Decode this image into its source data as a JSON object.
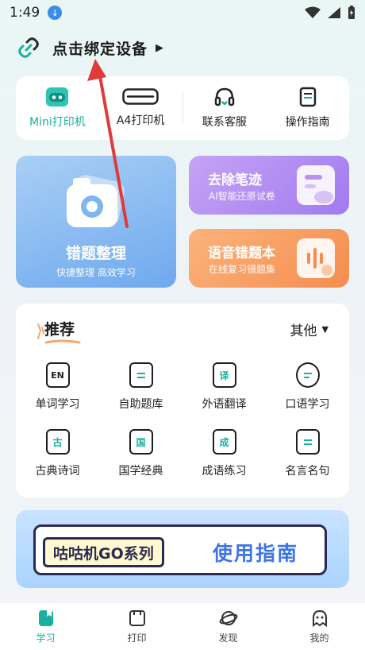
{
  "status": {
    "time": "1:49"
  },
  "header": {
    "bind_text": "点击绑定设备"
  },
  "device_tabs": [
    {
      "label": "Mini打印机",
      "active": true
    },
    {
      "label": "A4打印机",
      "active": false
    },
    {
      "label": "联系客服",
      "active": false
    },
    {
      "label": "操作指南",
      "active": false
    }
  ],
  "tiles": {
    "main": {
      "title": "错题整理",
      "subtitle": "快捷整理 高效学习"
    },
    "erase": {
      "title": "去除笔迹",
      "subtitle": "AI智能还原试卷"
    },
    "voice": {
      "title": "语音错题本",
      "subtitle": "在线复习错题集"
    }
  },
  "recommend": {
    "title": "推荐",
    "other": "其他",
    "items": [
      {
        "label": "单词学习",
        "glyph": "EN"
      },
      {
        "label": "自助题库",
        "glyph": ""
      },
      {
        "label": "外语翻译",
        "glyph": "译"
      },
      {
        "label": "口语学习",
        "glyph": ""
      },
      {
        "label": "古典诗词",
        "glyph": "古"
      },
      {
        "label": "国学经典",
        "glyph": "国"
      },
      {
        "label": "成语练习",
        "glyph": "成"
      },
      {
        "label": "名言名句",
        "glyph": ""
      }
    ]
  },
  "banner": {
    "left_text": "咕咕机GO系列",
    "right_text": "使用指南"
  },
  "tabbar": [
    {
      "label": "学习",
      "active": true
    },
    {
      "label": "打印",
      "active": false
    },
    {
      "label": "发现",
      "active": false
    },
    {
      "label": "我的",
      "active": false
    }
  ],
  "colors": {
    "accent": "#19b0a0",
    "annotation": "#e03a3a"
  }
}
